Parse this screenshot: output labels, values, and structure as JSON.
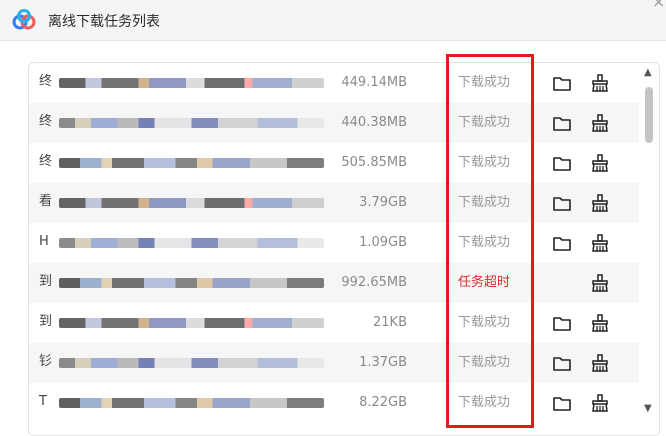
{
  "window": {
    "title": "离线下载任务列表",
    "close_mark": "×"
  },
  "rows": [
    {
      "glyph": "终",
      "size": "449.14MB",
      "status": "下载成功",
      "state": "ok",
      "has_folder": true
    },
    {
      "glyph": "终",
      "size": "440.38MB",
      "status": "下载成功",
      "state": "ok",
      "has_folder": true
    },
    {
      "glyph": "终",
      "size": "505.85MB",
      "status": "下载成功",
      "state": "ok",
      "has_folder": true
    },
    {
      "glyph": "看",
      "size": "3.79GB",
      "status": "下载成功",
      "state": "ok",
      "has_folder": true
    },
    {
      "glyph": "H",
      "size": "1.09GB",
      "status": "下载成功",
      "state": "ok",
      "has_folder": true
    },
    {
      "glyph": "到",
      "size": "992.65MB",
      "status": "任务超时",
      "state": "fail",
      "has_folder": false
    },
    {
      "glyph": "到",
      "size": "21KB",
      "status": "下载成功",
      "state": "ok",
      "has_folder": true
    },
    {
      "glyph": "钐",
      "size": "1.37GB",
      "status": "下载成功",
      "state": "ok",
      "has_folder": true
    },
    {
      "glyph": "T",
      "size": "8.22GB",
      "status": "下载成功",
      "state": "ok",
      "has_folder": true
    }
  ],
  "icons": {
    "folder": "folder-icon",
    "clean": "broom-icon",
    "logo": "cloud-logo-icon"
  },
  "colors": {
    "fail": "#e02a2a",
    "highlight": "#e11b1b",
    "status_ok": "#9a9a9a"
  }
}
